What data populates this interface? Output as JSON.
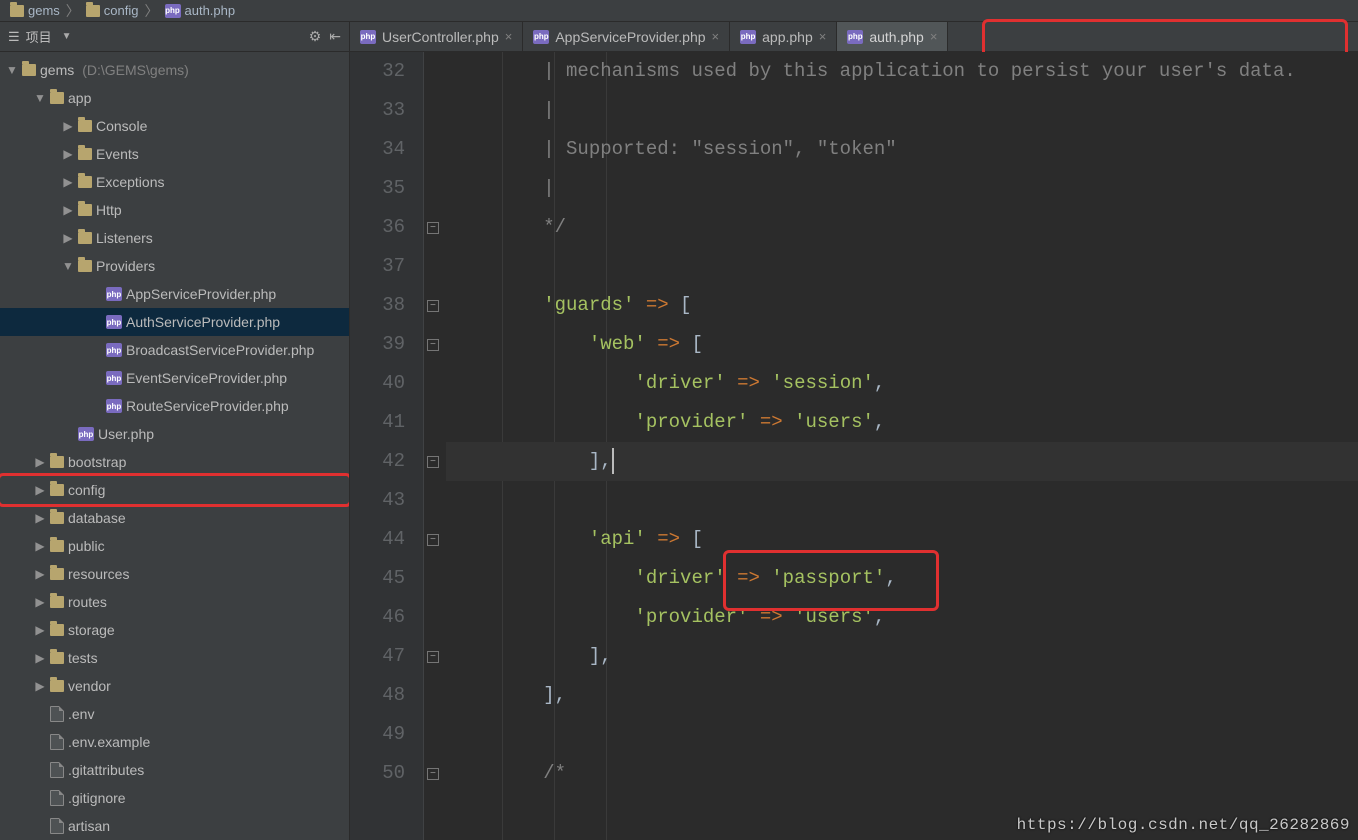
{
  "breadcrumb": {
    "items": [
      {
        "type": "folder",
        "name": "gems"
      },
      {
        "type": "folder",
        "name": "config"
      },
      {
        "type": "php",
        "name": "auth.php"
      }
    ],
    "sep": "〉"
  },
  "side": {
    "panel_label": "项目",
    "view_icon": "file-tree-icon",
    "tree": [
      {
        "d": 0,
        "a": "open",
        "icon": "folder",
        "label": "gems",
        "meta": "(D:\\GEMS\\gems)"
      },
      {
        "d": 1,
        "a": "open",
        "icon": "folder",
        "label": "app"
      },
      {
        "d": 2,
        "a": "closed",
        "icon": "folder",
        "label": "Console"
      },
      {
        "d": 2,
        "a": "closed",
        "icon": "folder",
        "label": "Events"
      },
      {
        "d": 2,
        "a": "closed",
        "icon": "folder",
        "label": "Exceptions"
      },
      {
        "d": 2,
        "a": "closed",
        "icon": "folder",
        "label": "Http"
      },
      {
        "d": 2,
        "a": "closed",
        "icon": "folder",
        "label": "Listeners"
      },
      {
        "d": 2,
        "a": "open",
        "icon": "folder",
        "label": "Providers"
      },
      {
        "d": 3,
        "a": "none",
        "icon": "php",
        "label": "AppServiceProvider.php"
      },
      {
        "d": 3,
        "a": "none",
        "icon": "php",
        "label": "AuthServiceProvider.php",
        "sel": true
      },
      {
        "d": 3,
        "a": "none",
        "icon": "php",
        "label": "BroadcastServiceProvider.php"
      },
      {
        "d": 3,
        "a": "none",
        "icon": "php",
        "label": "EventServiceProvider.php"
      },
      {
        "d": 3,
        "a": "none",
        "icon": "php",
        "label": "RouteServiceProvider.php"
      },
      {
        "d": 2,
        "a": "none",
        "icon": "php",
        "label": "User.php"
      },
      {
        "d": 1,
        "a": "closed",
        "icon": "folder",
        "label": "bootstrap"
      },
      {
        "d": 1,
        "a": "closed",
        "icon": "folder",
        "label": "config",
        "hl": true
      },
      {
        "d": 1,
        "a": "closed",
        "icon": "folder",
        "label": "database"
      },
      {
        "d": 1,
        "a": "closed",
        "icon": "folder",
        "label": "public"
      },
      {
        "d": 1,
        "a": "closed",
        "icon": "folder",
        "label": "resources"
      },
      {
        "d": 1,
        "a": "closed",
        "icon": "folder",
        "label": "routes"
      },
      {
        "d": 1,
        "a": "closed",
        "icon": "folder",
        "label": "storage"
      },
      {
        "d": 1,
        "a": "closed",
        "icon": "folder",
        "label": "tests"
      },
      {
        "d": 1,
        "a": "closed",
        "icon": "folder",
        "label": "vendor"
      },
      {
        "d": 1,
        "a": "none",
        "icon": "file",
        "label": ".env"
      },
      {
        "d": 1,
        "a": "none",
        "icon": "file",
        "label": ".env.example"
      },
      {
        "d": 1,
        "a": "none",
        "icon": "file",
        "label": ".gitattributes"
      },
      {
        "d": 1,
        "a": "none",
        "icon": "file",
        "label": ".gitignore"
      },
      {
        "d": 1,
        "a": "none",
        "icon": "file",
        "label": "artisan"
      }
    ]
  },
  "tabs": [
    {
      "name": "UserController.php",
      "active": false
    },
    {
      "name": "AppServiceProvider.php",
      "active": false
    },
    {
      "name": "app.php",
      "active": false
    },
    {
      "name": "auth.php",
      "active": true,
      "hl": true
    }
  ],
  "code": {
    "first_line": 32,
    "caret_line": 42,
    "fold_marks": {
      "36": "up",
      "38": "down",
      "39": "down",
      "42": "up",
      "44": "down",
      "47": "up",
      "50": "down"
    },
    "lines": [
      {
        "n": 32,
        "seg": [
          {
            "t": "        ",
            "c": ""
          },
          {
            "t": "| mechanisms used by this application to persist your user's data.",
            "c": "cmt"
          }
        ]
      },
      {
        "n": 33,
        "seg": [
          {
            "t": "        ",
            "c": ""
          },
          {
            "t": "|",
            "c": "cmt"
          }
        ]
      },
      {
        "n": 34,
        "seg": [
          {
            "t": "        ",
            "c": ""
          },
          {
            "t": "| Supported: \"session\", \"token\"",
            "c": "cmt"
          }
        ]
      },
      {
        "n": 35,
        "seg": [
          {
            "t": "        ",
            "c": ""
          },
          {
            "t": "|",
            "c": "cmt"
          }
        ]
      },
      {
        "n": 36,
        "seg": [
          {
            "t": "        ",
            "c": ""
          },
          {
            "t": "*/",
            "c": "cmt"
          }
        ]
      },
      {
        "n": 37,
        "seg": []
      },
      {
        "n": 38,
        "seg": [
          {
            "t": "        ",
            "c": ""
          },
          {
            "t": "'guards'",
            "c": "str"
          },
          {
            "t": " ",
            "c": ""
          },
          {
            "t": "=>",
            "c": "op"
          },
          {
            "t": " [",
            "c": "punc"
          }
        ]
      },
      {
        "n": 39,
        "seg": [
          {
            "t": "            ",
            "c": ""
          },
          {
            "t": "'web'",
            "c": "str"
          },
          {
            "t": " ",
            "c": ""
          },
          {
            "t": "=>",
            "c": "op"
          },
          {
            "t": " [",
            "c": "punc"
          }
        ]
      },
      {
        "n": 40,
        "seg": [
          {
            "t": "                ",
            "c": ""
          },
          {
            "t": "'driver'",
            "c": "str"
          },
          {
            "t": " ",
            "c": ""
          },
          {
            "t": "=>",
            "c": "op"
          },
          {
            "t": " ",
            "c": ""
          },
          {
            "t": "'session'",
            "c": "str"
          },
          {
            "t": ",",
            "c": "punc"
          }
        ]
      },
      {
        "n": 41,
        "seg": [
          {
            "t": "                ",
            "c": ""
          },
          {
            "t": "'provider'",
            "c": "str"
          },
          {
            "t": " ",
            "c": ""
          },
          {
            "t": "=>",
            "c": "op"
          },
          {
            "t": " ",
            "c": ""
          },
          {
            "t": "'users'",
            "c": "str"
          },
          {
            "t": ",",
            "c": "punc"
          }
        ]
      },
      {
        "n": 42,
        "seg": [
          {
            "t": "            ",
            "c": ""
          },
          {
            "t": "],",
            "c": "punc"
          }
        ],
        "hl": true,
        "caret": true
      },
      {
        "n": 43,
        "seg": []
      },
      {
        "n": 44,
        "seg": [
          {
            "t": "            ",
            "c": ""
          },
          {
            "t": "'api'",
            "c": "str"
          },
          {
            "t": " ",
            "c": ""
          },
          {
            "t": "=>",
            "c": "op"
          },
          {
            "t": " [",
            "c": "punc"
          }
        ]
      },
      {
        "n": 45,
        "seg": [
          {
            "t": "                ",
            "c": ""
          },
          {
            "t": "'driver'",
            "c": "str"
          },
          {
            "t": " ",
            "c": ""
          },
          {
            "t": "=>",
            "c": "op"
          },
          {
            "t": " ",
            "c": ""
          },
          {
            "t": "'passport'",
            "c": "str",
            "hl": true
          },
          {
            "t": ",",
            "c": "punc"
          }
        ]
      },
      {
        "n": 46,
        "seg": [
          {
            "t": "                ",
            "c": ""
          },
          {
            "t": "'provider'",
            "c": "str"
          },
          {
            "t": " ",
            "c": ""
          },
          {
            "t": "=>",
            "c": "op"
          },
          {
            "t": " ",
            "c": ""
          },
          {
            "t": "'users'",
            "c": "str"
          },
          {
            "t": ",",
            "c": "punc"
          }
        ]
      },
      {
        "n": 47,
        "seg": [
          {
            "t": "            ",
            "c": ""
          },
          {
            "t": "],",
            "c": "punc"
          }
        ]
      },
      {
        "n": 48,
        "seg": [
          {
            "t": "        ",
            "c": ""
          },
          {
            "t": "],",
            "c": "punc"
          }
        ]
      },
      {
        "n": 49,
        "seg": []
      },
      {
        "n": 50,
        "seg": [
          {
            "t": "        ",
            "c": ""
          },
          {
            "t": "/*",
            "c": "cmt"
          }
        ]
      }
    ]
  },
  "watermark": "https://blog.csdn.net/qq_26282869"
}
